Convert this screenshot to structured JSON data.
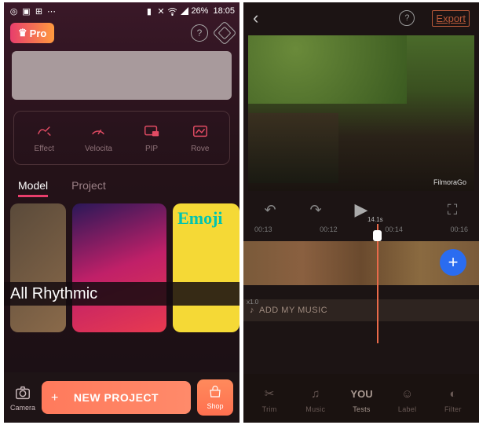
{
  "left": {
    "status": {
      "battery_pct": "26%",
      "time": "18:05"
    },
    "pro": {
      "label": "Pro"
    },
    "tools": [
      {
        "name": "effect",
        "label": "Effect"
      },
      {
        "name": "velocity",
        "label": "Velocita"
      },
      {
        "name": "pip",
        "label": "PIP"
      },
      {
        "name": "rove",
        "label": "Rove"
      }
    ],
    "sections": {
      "model": "Model",
      "project": "Project"
    },
    "rhythm": "All Rhythmic",
    "emoji_card_title": "Emoji",
    "bottom": {
      "camera": "Camera",
      "new_project": "NEW PROJECT",
      "shop": "Shop"
    }
  },
  "right": {
    "header": {
      "export": "Export"
    },
    "watermark": "FilmoraGo",
    "ruler": [
      "00:13",
      "00:12",
      "00:14",
      "00:16"
    ],
    "timeline": {
      "scale": "x1.0",
      "playhead_time": "14.1s"
    },
    "music_row": "ADD MY MUSIC",
    "tools": [
      {
        "name": "trim",
        "label": "Trim"
      },
      {
        "name": "music",
        "label": "Music"
      },
      {
        "name": "tests",
        "label": "Tests",
        "big": "YOU"
      },
      {
        "name": "label",
        "label": "Label"
      },
      {
        "name": "filter",
        "label": "Filter"
      }
    ]
  }
}
